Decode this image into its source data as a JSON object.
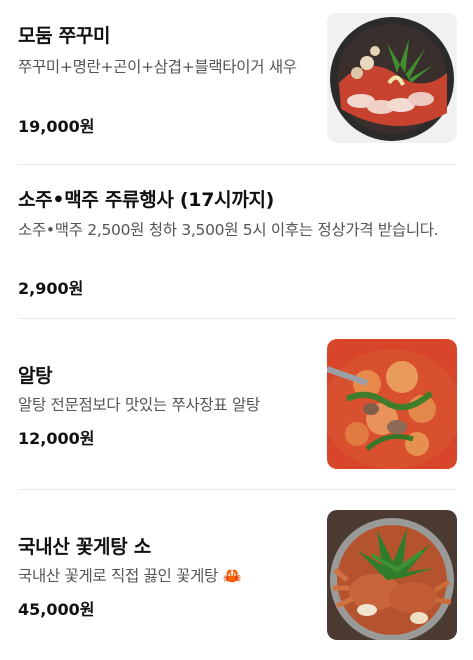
{
  "menu": {
    "items": [
      {
        "name": "모둠 쭈꾸미",
        "description": "쭈꾸미+명란+곤이+삼겹+블랙타이거 새우",
        "price": "19,000원",
        "has_image": true
      },
      {
        "name": "소주•맥주 주류행사 (17시까지)",
        "description": "소주•맥주 2,500원 청하 3,500원 5시 이후는 정상가격 받습니다.",
        "price": "2,900원",
        "has_image": false
      },
      {
        "name": "알탕",
        "description": "알탕 전문점보다 맛있는 쭈사장표 알탕",
        "price": "12,000원",
        "has_image": true
      },
      {
        "name": "국내산 꽃게탕 소",
        "description": "국내산 꽃게로 직접 끓인 꽃게탕 🦀",
        "price": "45,000원",
        "has_image": true
      }
    ]
  },
  "colors": {
    "text": "#111111",
    "description": "#555555",
    "divider": "#ececec"
  }
}
